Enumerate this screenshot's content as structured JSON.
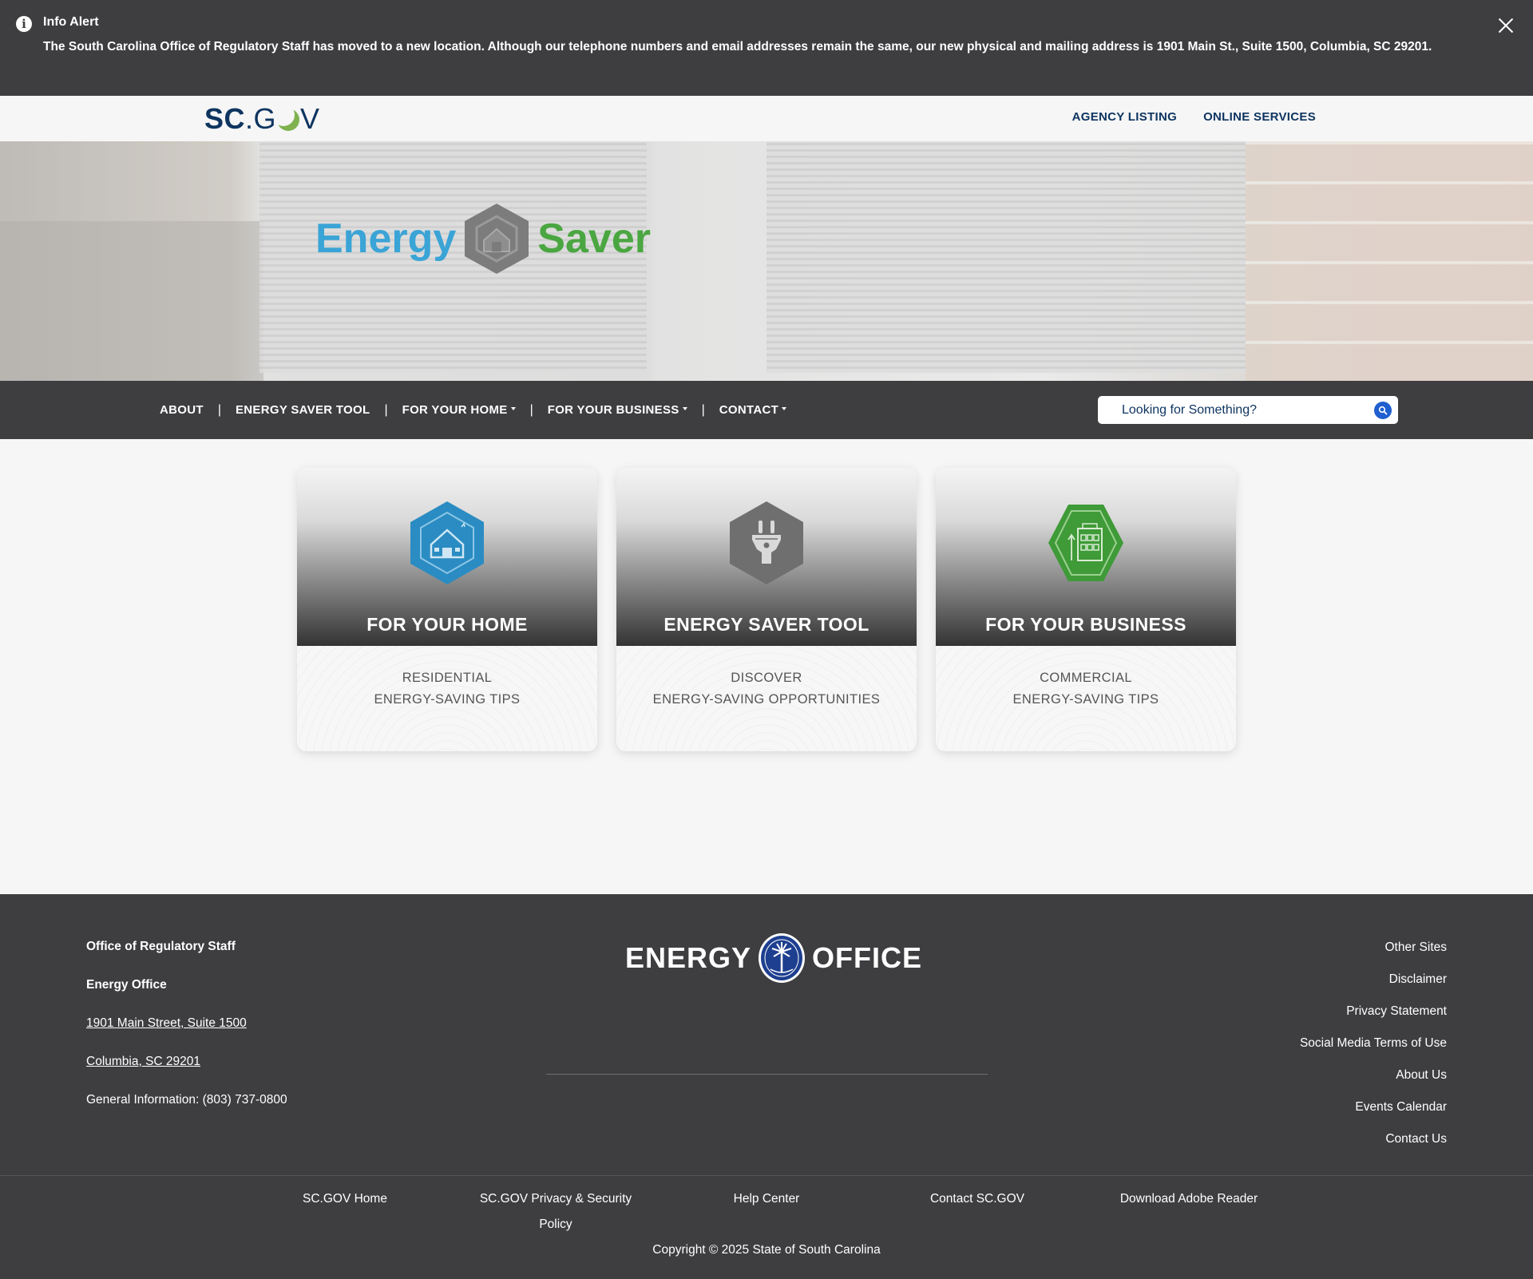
{
  "alert": {
    "title": "Info Alert",
    "icon": "info-icon",
    "message": "The South Carolina Office of Regulatory Staff has moved to a new location. Although our telephone numbers and email addresses remain the same, our new physical and mailing address is 1901 Main St., Suite 1500, Columbia, SC 29201.",
    "close_icon": "close-icon"
  },
  "topbar": {
    "logo": {
      "sc": "SC",
      "dot": ".",
      "g": "G",
      "v": "V"
    },
    "links": [
      "AGENCY LISTING",
      "ONLINE SERVICES"
    ]
  },
  "hero": {
    "logo_left": "Energy",
    "logo_right": "Saver"
  },
  "nav": {
    "items": [
      {
        "label": "ABOUT",
        "dropdown": false
      },
      {
        "label": "ENERGY SAVER TOOL",
        "dropdown": false
      },
      {
        "label": "FOR YOUR HOME",
        "dropdown": true
      },
      {
        "label": "FOR YOUR BUSINESS",
        "dropdown": true
      },
      {
        "label": "CONTACT",
        "dropdown": true
      }
    ],
    "search_placeholder": "Looking for Something?"
  },
  "cards": [
    {
      "title": "FOR YOUR HOME",
      "line1": "RESIDENTIAL",
      "line2": "ENERGY-SAVING TIPS",
      "icon": "house-icon",
      "color": "#2a8cc2"
    },
    {
      "title": "ENERGY SAVER TOOL",
      "line1": "DISCOVER",
      "line2": "ENERGY-SAVING OPPORTUNITIES",
      "icon": "plug-icon",
      "color": "#6f6f70"
    },
    {
      "title": "FOR YOUR BUSINESS",
      "line1": "COMMERCIAL",
      "line2": "ENERGY-SAVING TIPS",
      "icon": "building-icon",
      "color": "#3f9a38"
    }
  ],
  "footer": {
    "org": "Office of Regulatory Staff",
    "dept": "Energy Office",
    "address1": "1901 Main Street, Suite 1500",
    "address2": "Columbia, SC 29201",
    "phone": "General Information: (803) 737-0800",
    "logo_left": "ENERGY",
    "logo_right": "OFFICE",
    "links": [
      "Other Sites",
      "Disclaimer",
      "Privacy Statement",
      "Social Media Terms of Use",
      "About Us",
      "Events Calendar",
      "Contact Us"
    ],
    "bottom_links": [
      "SC.GOV Home",
      "SC.GOV Privacy & Security Policy",
      "Help Center",
      "Contact SC.GOV",
      "Download Adobe Reader"
    ],
    "copyright": "Copyright © 2025 State of South Carolina"
  },
  "colors": {
    "dark_bar": "#3e3e41",
    "navy": "#0e3560",
    "energy_blue": "#3ba4d6",
    "saver_green": "#4aa641",
    "search_button": "#1f5fcf"
  }
}
